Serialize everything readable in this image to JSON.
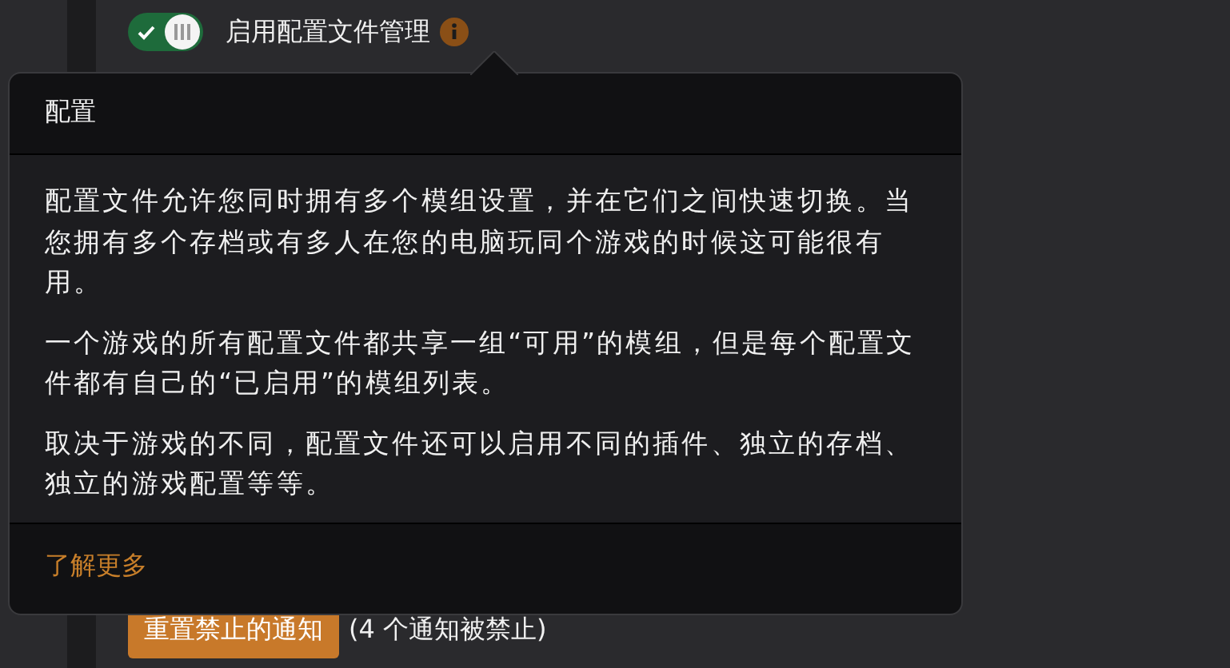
{
  "toggle": {
    "on": true,
    "label": "启用配置文件管理"
  },
  "popover": {
    "title": "配置",
    "paragraphs": [
      "配置文件允许您同时拥有多个模组设置，并在它们之间快速切换。当您拥有多个存档或有多人在您的电脑玩同个游戏的时候这可能很有用。",
      "一个游戏的所有配置文件都共享一组“可用”的模组，但是每个配置文件都有自己的“已启用”的模组列表。",
      "取决于游戏的不同，配置文件还可以启用不同的插件、独立的存档、独立的游戏配置等等。"
    ],
    "link": "了解更多"
  },
  "reset": {
    "button": "重置禁止的通知",
    "note": "(4 个通知被禁止)"
  }
}
